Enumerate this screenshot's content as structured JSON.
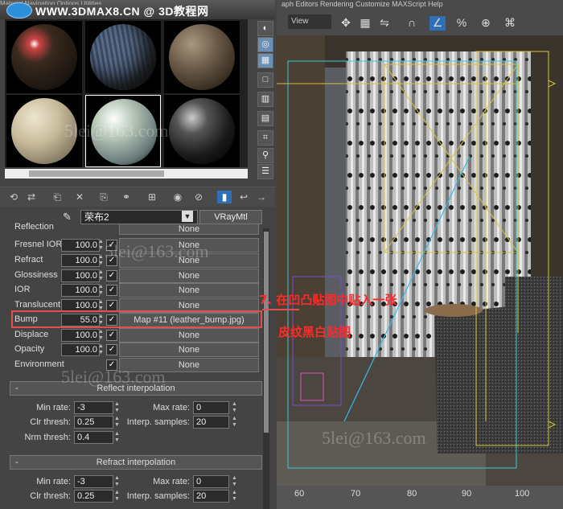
{
  "banner": {
    "text": "WWW.3DMAX8.CN @ 3D教程网",
    "menu": "Material   Navigation   Options   Utilities"
  },
  "viewport_menu": "aph Editors    Rendering    Customize    MAXScript    Help",
  "viewport_tab": "View",
  "material": {
    "name": "荣布2",
    "type": "VRayMtl"
  },
  "maps": [
    {
      "label": "Reflection",
      "value": "",
      "map": "None"
    },
    {
      "label": "Fresnel IOR",
      "value": "100.0",
      "map": "None"
    },
    {
      "label": "Refract",
      "value": "100.0",
      "map": "None"
    },
    {
      "label": "Glossiness",
      "value": "100.0",
      "map": "None"
    },
    {
      "label": "IOR",
      "value": "100.0",
      "map": "None"
    },
    {
      "label": "Translucent",
      "value": "100.0",
      "map": "None"
    },
    {
      "label": "Bump",
      "value": "55.0",
      "map": "Map #11 (leather_bump.jpg)"
    },
    {
      "label": "Displace",
      "value": "100.0",
      "map": "None"
    },
    {
      "label": "Opacity",
      "value": "100.0",
      "map": "None"
    },
    {
      "label": "Environment",
      "value": "",
      "map": "None"
    }
  ],
  "reflect_interp": {
    "title": "Reflect interpolation",
    "min_rate_label": "Min rate:",
    "min_rate": "-3",
    "max_rate_label": "Max rate:",
    "max_rate": "0",
    "clr_thresh_label": "Clr thresh:",
    "clr_thresh": "0.25",
    "interp_samples_label": "Interp. samples:",
    "interp_samples": "20",
    "nrm_thresh_label": "Nrm thresh:",
    "nrm_thresh": "0.4"
  },
  "refract_interp": {
    "title": "Refract interpolation",
    "min_rate_label": "Min rate:",
    "min_rate": "-3",
    "max_rate_label": "Max rate:",
    "max_rate": "0",
    "clr_thresh_label": "Clr thresh:",
    "clr_thresh": "0.25",
    "interp_samples_label": "Interp. samples:",
    "interp_samples": "20"
  },
  "annotation": {
    "line1": "7. 在凹凸贴图中贴入一张",
    "line2": "皮纹黑白贴图"
  },
  "watermark": "5lei@163.com",
  "ruler": [
    "60",
    "70",
    "80",
    "90",
    "100"
  ],
  "colors": {
    "accent": "#e05050",
    "highlight": "#2f6fb5"
  }
}
